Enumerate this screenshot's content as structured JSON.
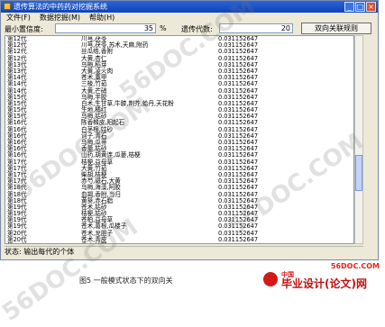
{
  "window": {
    "title": "遗传算法的中药药对挖掘系统"
  },
  "menu": [
    "文件(F)",
    "数据挖掘(M)",
    "帮助(H)"
  ],
  "toolbar": {
    "min_confidence_label": "最小置信度:",
    "min_confidence_value": "35",
    "percent": "%",
    "generations_label": "遗传代数:",
    "generations_value": "20",
    "mine_button": "双向关联规则"
  },
  "rows": [
    [
      "第12代",
      "川芎,茯苓",
      "0.031152647"
    ],
    [
      "第12代",
      "川芎,茯苓,苏术,天麻,附药",
      "0.031152647"
    ],
    [
      "第12代",
      "丝瓜络,香附",
      "0.031152647"
    ],
    [
      "第12代",
      "大黄,杏仁",
      "0.031152647"
    ],
    [
      "第13代",
      "乌梅,稻芽",
      "0.031152647"
    ],
    [
      "第13代",
      "大黄,凌火肉",
      "0.031152647"
    ],
    [
      "第14代",
      "苍术,藁甲",
      "0.031152647"
    ],
    [
      "第14代",
      "三棱,竹茹",
      "0.031152647"
    ],
    [
      "第14代",
      "大黄,芒硝",
      "0.031152647"
    ],
    [
      "第15代",
      "乌梅,半胶",
      "0.031152647"
    ],
    [
      "第15代",
      "白术,生甘草,牛膝,荆芥,蛤丹,天花粉",
      "0.031152647"
    ],
    [
      "第15代",
      "生地,橘红",
      "0.031152647"
    ],
    [
      "第15代",
      "乌梅,姑砂",
      "0.031152647"
    ],
    [
      "第16代",
      "陈香橼皮,阳起石",
      "0.031152647"
    ],
    [
      "第16代",
      "白茅根,姑砂",
      "0.031152647"
    ],
    [
      "第16代",
      "诃子,青石",
      "0.031152647"
    ],
    [
      "第16代",
      "乌梅,瓜蒂",
      "0.031152647"
    ],
    [
      "第16代",
      "香薷,姑砂",
      "0.031152647"
    ],
    [
      "第16代",
      "山药,胡黄连,瓜蒌,桔梗",
      "0.031152647"
    ],
    [
      "第17代",
      "桔梗,益母草",
      "0.031152647"
    ],
    [
      "第17代",
      "大黄,竹茹",
      "0.031152647"
    ],
    [
      "第17代",
      "柴胡,桔梗",
      "0.031152647"
    ],
    [
      "第17代",
      "赤芍,磁石,大黄",
      "0.031152647"
    ],
    [
      "第18代",
      "乌梅,海藻,阿胶",
      "0.031152647"
    ],
    [
      "第18代",
      "血竭,香附,当归",
      "0.031152647"
    ],
    [
      "第18代",
      "黄葵,赤石脂",
      "0.031152647"
    ],
    [
      "第19代",
      "苍术,姑砂",
      "0.031152647"
    ],
    [
      "第19代",
      "桔梗,姑砂",
      "0.031152647"
    ],
    [
      "第19代",
      "苍柏,益母草",
      "0.031152647"
    ],
    [
      "第19代",
      "苍术,葛根,瓜楼子",
      "0.031152647"
    ],
    [
      "第20代",
      "苍术,龙胆子",
      "0.031152647"
    ],
    [
      "第20代",
      "苍术,青皮",
      "0.031152647"
    ],
    [
      "第20代",
      "桑叶,竹茹",
      "0.031152647"
    ]
  ],
  "status": "状态: 输出每代的个体",
  "caption": "图5  一般模式状态下的双向关",
  "logo": {
    "top": "中国",
    "main": "毕业设计(论文)网"
  },
  "watermarks": [
    "56DOC.COM",
    "56DOC.COM",
    "56DOC.COM",
    "56DOC.COM"
  ],
  "red_mark": "56DOC.COM"
}
